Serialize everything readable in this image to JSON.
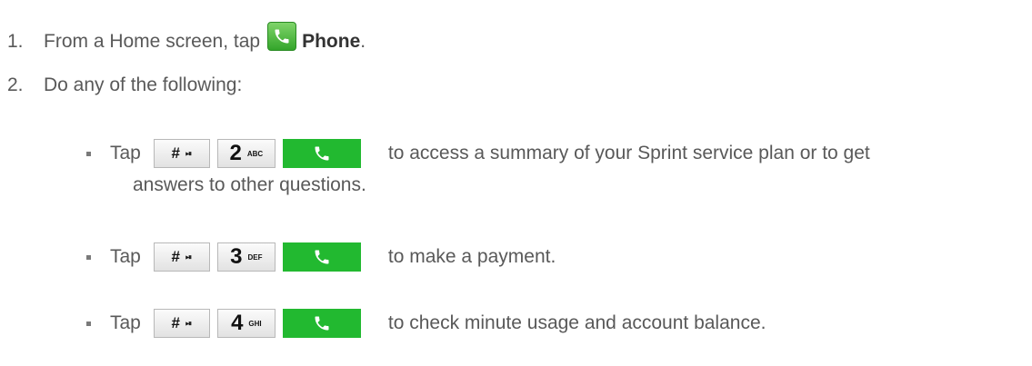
{
  "step1": {
    "number": "1.",
    "text_before": "From a Home screen, tap",
    "app_label": "Phone",
    "text_after": ".",
    "icon": "phone-app-icon"
  },
  "step2": {
    "number": "2.",
    "text": "Do any of the following:"
  },
  "keys": {
    "hash_main": "#",
    "hash_sub": "⏯",
    "call_icon": "phone-handset-icon"
  },
  "items": [
    {
      "lead": "Tap",
      "digit": "2",
      "letters": "ABC",
      "desc": "to access a summary of your Sprint service plan or to get",
      "desc_cont": "answers to other questions."
    },
    {
      "lead": "Tap",
      "digit": "3",
      "letters": "DEF",
      "desc": "to make a payment."
    },
    {
      "lead": "Tap",
      "digit": "4",
      "letters": "GHI",
      "desc": "to check minute usage and account balance."
    }
  ]
}
